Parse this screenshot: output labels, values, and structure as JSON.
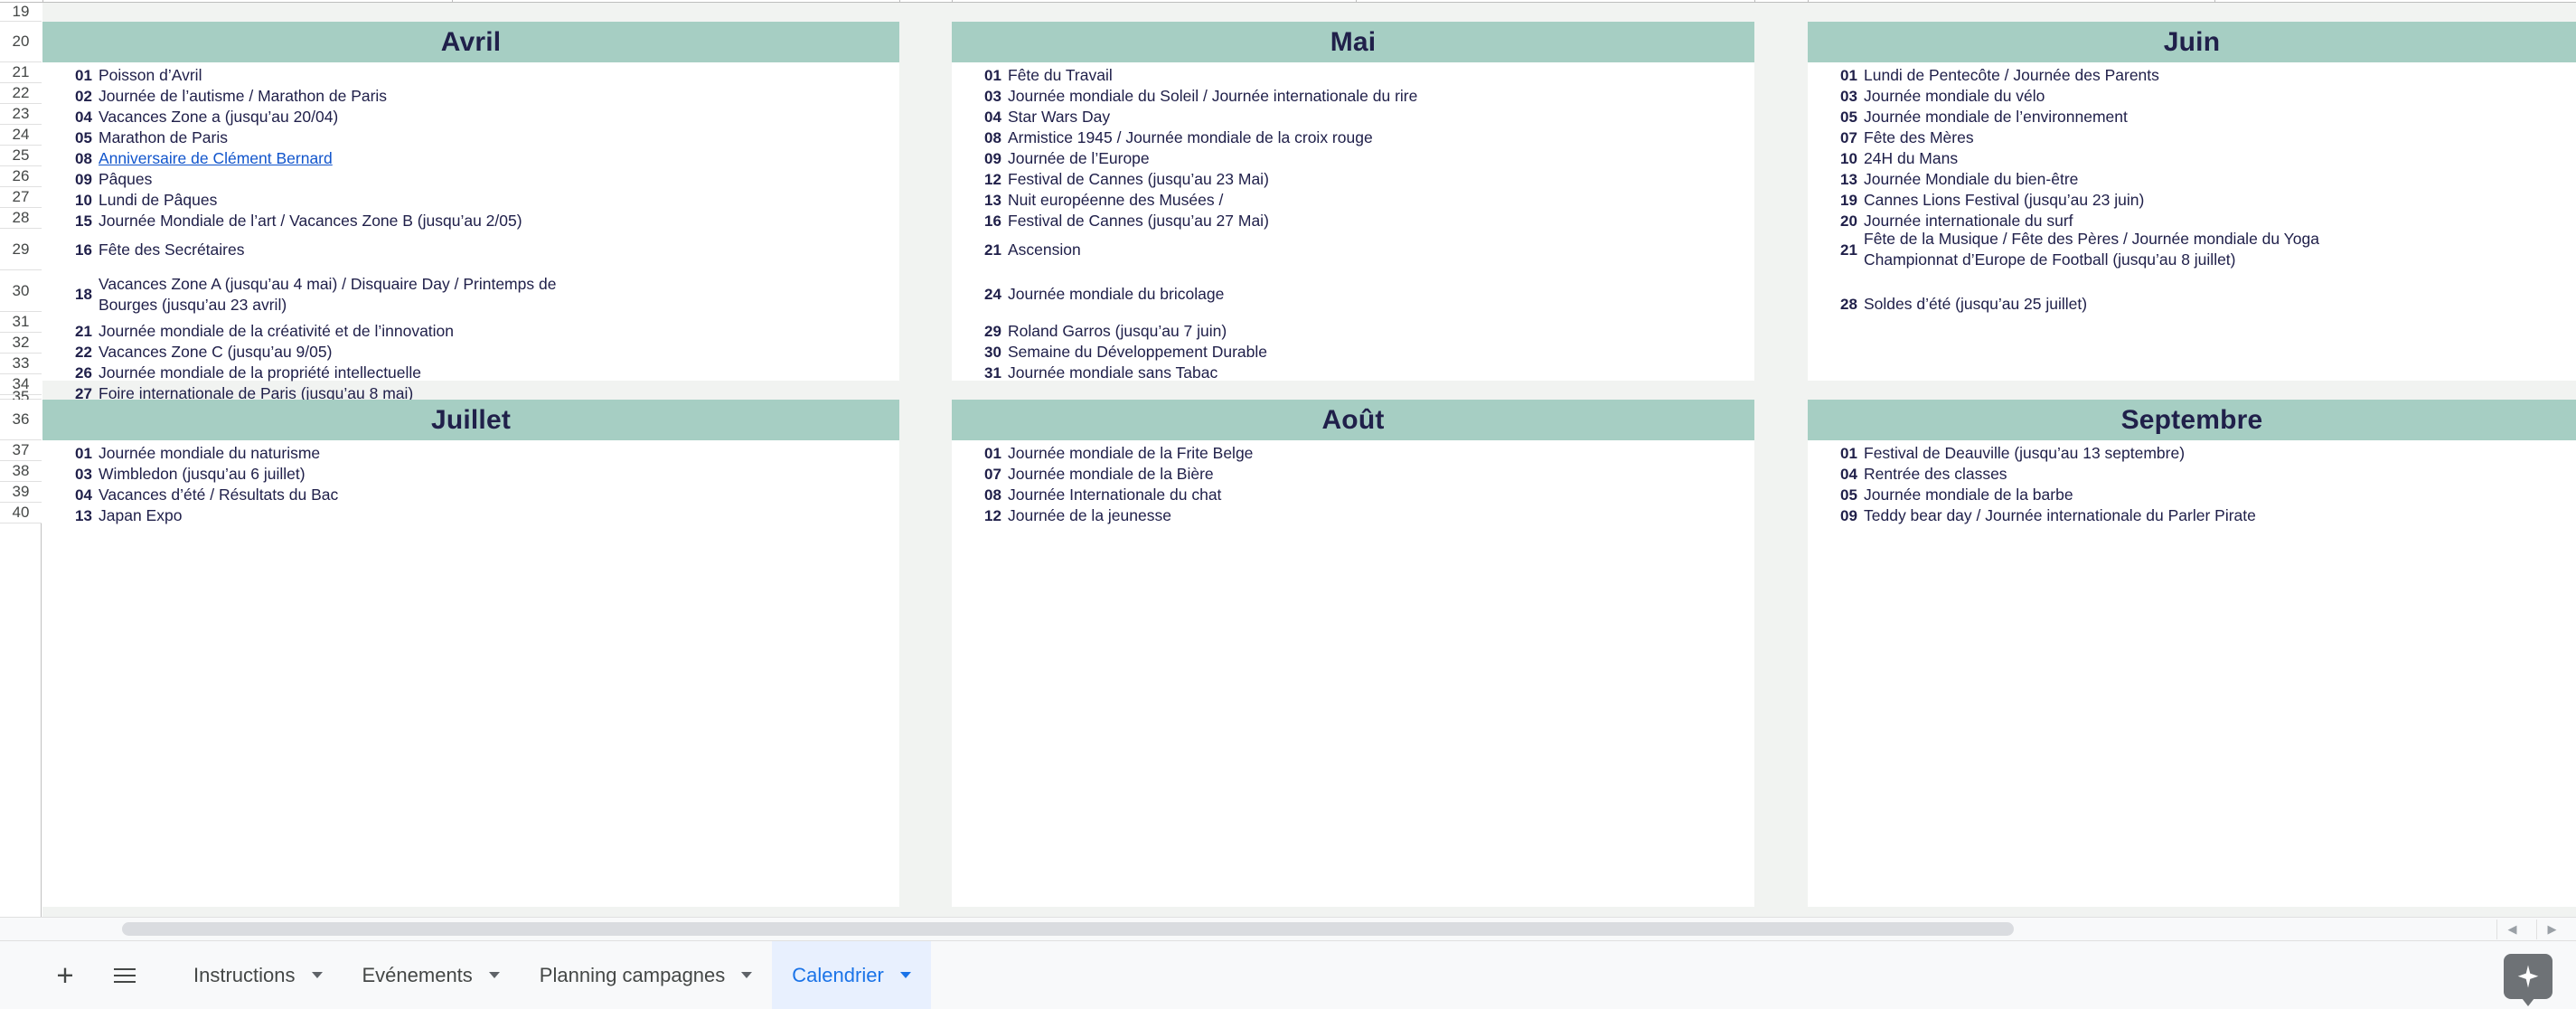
{
  "app": {
    "type": "spreadsheet",
    "accent_header_color": "#a6cec3",
    "text_color": "#20204a",
    "link_color": "#1155cc",
    "active_tab_color": "#1a73e8"
  },
  "grid": {
    "row_numbers": [
      "19",
      "20",
      "21",
      "22",
      "23",
      "24",
      "25",
      "26",
      "27",
      "28",
      "29",
      "30",
      "31",
      "32",
      "33",
      "34",
      "35",
      "36",
      "37",
      "38",
      "39",
      "40"
    ]
  },
  "months": [
    {
      "name": "Avril",
      "events": [
        {
          "day": "01",
          "label": "Poisson d’Avril",
          "link": false
        },
        {
          "day": "02",
          "label": "Journée de l’autisme / Marathon de Paris",
          "link": false
        },
        {
          "day": "04",
          "label": "Vacances Zone a (jusqu’au 20/04)",
          "link": false
        },
        {
          "day": "05",
          "label": "Marathon de Paris",
          "link": false
        },
        {
          "day": "08",
          "label": "Anniversaire de Clément Bernard",
          "link": true
        },
        {
          "day": "09",
          "label": "Pâques",
          "link": false
        },
        {
          "day": "10",
          "label": "Lundi de Pâques",
          "link": false
        },
        {
          "day": "15",
          "label": "Journée Mondiale de l’art / Vacances Zone B (jusqu’au 2/05)",
          "link": false
        },
        {
          "day": "16",
          "label": "Fête des Secrétaires",
          "link": false
        },
        {
          "day": "18",
          "label": "Vacances Zone A (jusqu’au 4 mai) / Disquaire Day / Printemps de\nBourges (jusqu’au 23 avril)",
          "link": false
        },
        {
          "day": "21",
          "label": "Journée mondiale de la créativité et de l’innovation",
          "link": false
        },
        {
          "day": "22",
          "label": "Vacances Zone C (jusqu’au 9/05)",
          "link": false
        },
        {
          "day": "26",
          "label": "Journée mondiale de la propriété intellectuelle",
          "link": false
        },
        {
          "day": "27",
          "label": "Foire internationale de Paris (jusqu’au 8 mai)",
          "link": false
        }
      ]
    },
    {
      "name": "Mai",
      "events": [
        {
          "day": "01",
          "label": "Fête du Travail",
          "link": false
        },
        {
          "day": "03",
          "label": "Journée mondiale du Soleil / Journée internationale du rire",
          "link": false
        },
        {
          "day": "04",
          "label": "Star Wars Day",
          "link": false
        },
        {
          "day": "08",
          "label": "Armistice 1945 / Journée mondiale de la croix rouge",
          "link": false
        },
        {
          "day": "09",
          "label": "Journée de l’Europe",
          "link": false
        },
        {
          "day": "12",
          "label": "Festival de Cannes (jusqu’au 23 Mai)",
          "link": false
        },
        {
          "day": "13",
          "label": "Nuit européenne des Musées /",
          "link": false
        },
        {
          "day": "16",
          "label": "Festival de Cannes (jusqu’au 27 Mai)",
          "link": false
        },
        {
          "day": "21",
          "label": "Ascension",
          "link": false
        },
        {
          "day": "24",
          "label": "Journée mondiale du bricolage",
          "link": false
        },
        {
          "day": "29",
          "label": "Roland Garros (jusqu’au 7 juin)",
          "link": false
        },
        {
          "day": "30",
          "label": "Semaine du Développement Durable",
          "link": false
        },
        {
          "day": "31",
          "label": "Journée mondiale sans Tabac",
          "link": false
        }
      ]
    },
    {
      "name": "Juin",
      "events": [
        {
          "day": "01",
          "label": "Lundi de Pentecôte / Journée des Parents",
          "link": false
        },
        {
          "day": "03",
          "label": "Journée mondiale du vélo",
          "link": false
        },
        {
          "day": "05",
          "label": "Journée mondiale de l’environnement",
          "link": false
        },
        {
          "day": "07",
          "label": "Fête des Mères",
          "link": false
        },
        {
          "day": "10",
          "label": "24H du Mans",
          "link": false
        },
        {
          "day": "13",
          "label": "Journée Mondiale du bien-être",
          "link": false
        },
        {
          "day": "19",
          "label": "Cannes Lions Festival (jusqu’au 23 juin)",
          "link": false
        },
        {
          "day": "20",
          "label": "Journée internationale du surf",
          "link": false
        },
        {
          "day": "21",
          "label": "Fête de la Musique / Fête des Pères / Journée mondiale du Yoga\nChampionnat d’Europe de Football (jusqu’au 8 juillet)",
          "link": false
        },
        {
          "day": "28",
          "label": "Soldes d’été (jusqu’au 25 juillet)",
          "link": false
        }
      ]
    },
    {
      "name": "Juillet",
      "events": [
        {
          "day": "01",
          "label": "Journée mondiale du naturisme",
          "link": false
        },
        {
          "day": "03",
          "label": "Wimbledon (jusqu’au 6 juillet)",
          "link": false
        },
        {
          "day": "04",
          "label": "Vacances d’été / Résultats du Bac",
          "link": false
        },
        {
          "day": "13",
          "label": "Japan Expo",
          "link": false
        }
      ]
    },
    {
      "name": "Août",
      "events": [
        {
          "day": "01",
          "label": "Journée mondiale de la Frite Belge",
          "link": false
        },
        {
          "day": "07",
          "label": "Journée mondiale de la Bière",
          "link": false
        },
        {
          "day": "08",
          "label": "Journée Internationale du chat",
          "link": false
        },
        {
          "day": "12",
          "label": "Journée de la jeunesse",
          "link": false
        }
      ]
    },
    {
      "name": "Septembre",
      "events": [
        {
          "day": "01",
          "label": "Festival de Deauville (jusqu’au 13 septembre)",
          "link": false
        },
        {
          "day": "04",
          "label": "Rentrée des classes",
          "link": false
        },
        {
          "day": "05",
          "label": "Journée mondiale de la barbe",
          "link": false
        },
        {
          "day": "09",
          "label": "Teddy bear day / Journée internationale du Parler Pirate",
          "link": false
        }
      ]
    }
  ],
  "sheet_tabs": {
    "add_label": "+",
    "tabs": [
      {
        "label": "Instructions",
        "active": false
      },
      {
        "label": "Evénements",
        "active": false
      },
      {
        "label": "Planning campagnes",
        "active": false
      },
      {
        "label": "Calendrier",
        "active": true
      }
    ]
  },
  "scroll": {
    "left_arrow": "◀",
    "right_arrow": "▶"
  }
}
